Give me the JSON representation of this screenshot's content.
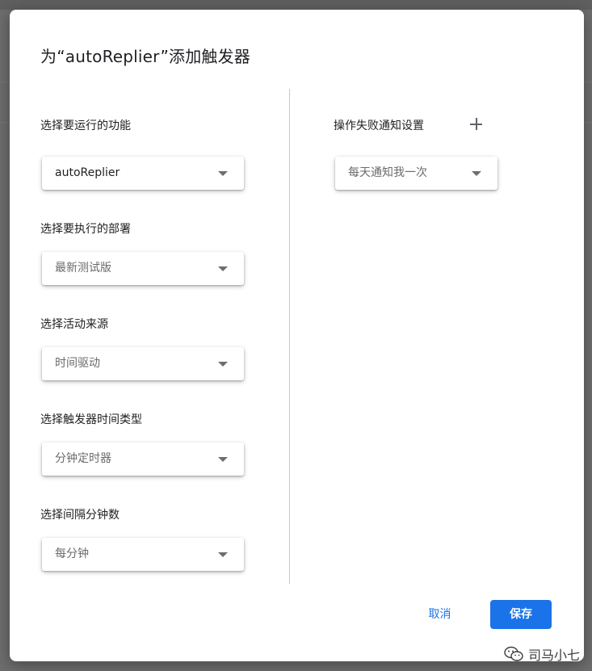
{
  "dialog": {
    "title": "为“autoReplier”添加触发器",
    "cancel_label": "取消",
    "save_label": "保存"
  },
  "left_fields": [
    {
      "label": "选择要运行的功能",
      "value": "autoReplier"
    },
    {
      "label": "选择要执行的部署",
      "value": "最新测试版"
    },
    {
      "label": "选择活动来源",
      "value": "时间驱动"
    },
    {
      "label": "选择触发器时间类型",
      "value": "分钟定时器"
    },
    {
      "label": "选择间隔分钟数",
      "value": "每分钟"
    }
  ],
  "right_section": {
    "label": "操作失败通知设置",
    "notify_value": "每天通知我一次"
  },
  "watermark": {
    "text": "司马小七"
  },
  "colors": {
    "primary": "#1a73e8",
    "overlay": "#6d6d6d"
  },
  "icons": {
    "caret": "caret-down-icon",
    "add": "plus-icon",
    "watermark": "wechat-icon"
  }
}
